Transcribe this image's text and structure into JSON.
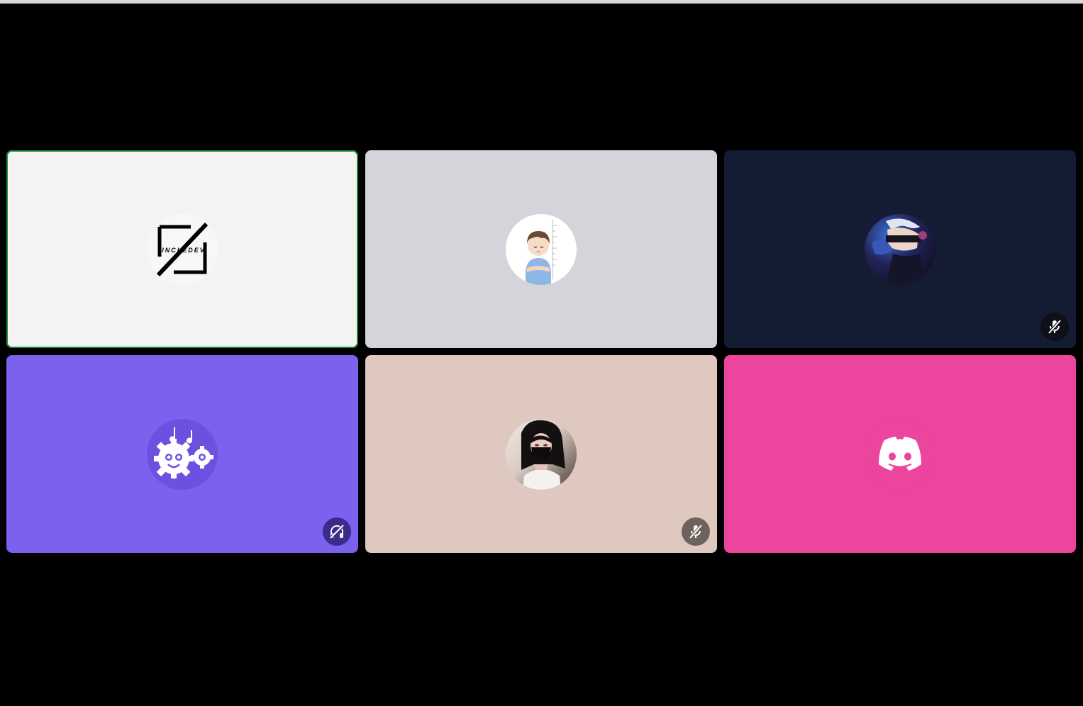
{
  "call": {
    "tiles": [
      {
        "logo_text": "UNCLEDEV",
        "avatar_icon": "uncledev-logo-icon",
        "bg": "#f3f3f3",
        "speaking": true,
        "speaking_color": "#1f8b3a",
        "status": "none"
      },
      {
        "avatar_icon": "anime-boy-avatar-icon",
        "bg": "#d4d5da",
        "speaking": false,
        "status": "none"
      },
      {
        "avatar_icon": "anime-blindfold-avatar-icon",
        "bg": "#141c33",
        "speaking": false,
        "status": "muted-microphone-icon"
      },
      {
        "avatar_icon": "music-gears-bot-icon",
        "bg": "#7b61ed",
        "speaking": false,
        "status": "deafened-headphones-icon"
      },
      {
        "avatar_icon": "masked-girl-avatar-icon",
        "bg": "#dfc8bf",
        "speaking": false,
        "status": "muted-microphone-icon"
      },
      {
        "avatar_icon": "discord-logo-icon",
        "bg": "#eb459e",
        "speaking": false,
        "status": "none"
      }
    ]
  }
}
